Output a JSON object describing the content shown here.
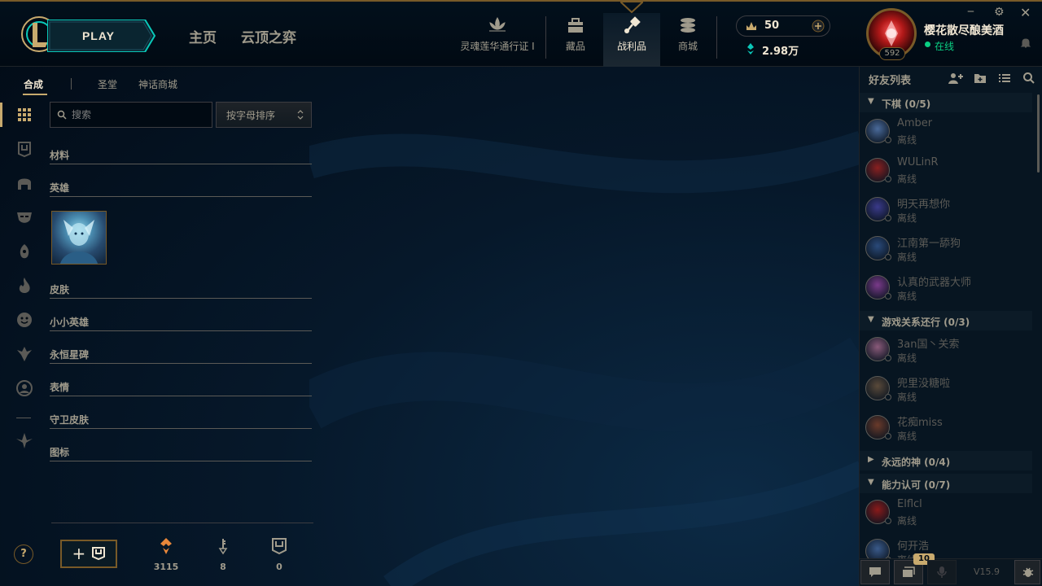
{
  "header": {
    "play_label": "PLAY",
    "nav": [
      "主页",
      "云顶之弈"
    ],
    "icons": [
      {
        "label": "灵魂莲华通行证 I",
        "icon": "lotus-icon"
      },
      {
        "label": "藏品",
        "icon": "collection-icon"
      },
      {
        "label": "战利品",
        "icon": "loot-icon"
      },
      {
        "label": "商城",
        "icon": "store-icon"
      }
    ],
    "rp": "50",
    "be": "2.98万",
    "profile": {
      "name": "樱花散尽酿美酒",
      "status": "在线",
      "level": "592"
    }
  },
  "loot": {
    "tabs": [
      "合成",
      "圣堂",
      "神话商城"
    ],
    "search_placeholder": "搜索",
    "sort_label": "按字母排序",
    "categories": [
      "材料",
      "英雄",
      "皮肤",
      "小小英雄",
      "永恒星碑",
      "表情",
      "守卫皮肤",
      "图标"
    ],
    "currencies": [
      {
        "icon": "orange-essence-icon",
        "value": "3115"
      },
      {
        "icon": "key-icon",
        "value": "8"
      },
      {
        "icon": "chest-icon",
        "value": "0"
      }
    ],
    "add_label": "+",
    "help_label": "?"
  },
  "friends": {
    "title": "好友列表",
    "groups": [
      {
        "name": "下棋 (0/5)",
        "friends": [
          {
            "name": "Amber",
            "status": "离线",
            "color": "#4a6a9a"
          },
          {
            "name": "WULinR",
            "status": "离线",
            "color": "#8a2020"
          },
          {
            "name": "明天再想你",
            "status": "离线",
            "color": "#3a3a8a"
          },
          {
            "name": "江南第一舔狗",
            "status": "离线",
            "color": "#2a4a7a"
          },
          {
            "name": "认真的武器大师",
            "status": "离线",
            "color": "#7a3a8a"
          }
        ]
      },
      {
        "name": "游戏关系还行 (0/3)",
        "friends": [
          {
            "name": "3an国丶关索",
            "status": "离线",
            "color": "#8a5a7a"
          },
          {
            "name": "兜里没糖啦",
            "status": "离线",
            "color": "#5a4a3a"
          },
          {
            "name": "花痴miss",
            "status": "离线",
            "color": "#6a3a2a"
          }
        ]
      },
      {
        "name": "永远的神 (0/4)",
        "friends": []
      },
      {
        "name": "能力认可 (0/7)",
        "friends": [
          {
            "name": "Elflcl",
            "status": "离线",
            "color": "#8a1a1a"
          },
          {
            "name": "何开浩",
            "status": "离线",
            "color": "#3a5a8a"
          }
        ]
      }
    ],
    "badge": "10",
    "version": "V15.9"
  }
}
